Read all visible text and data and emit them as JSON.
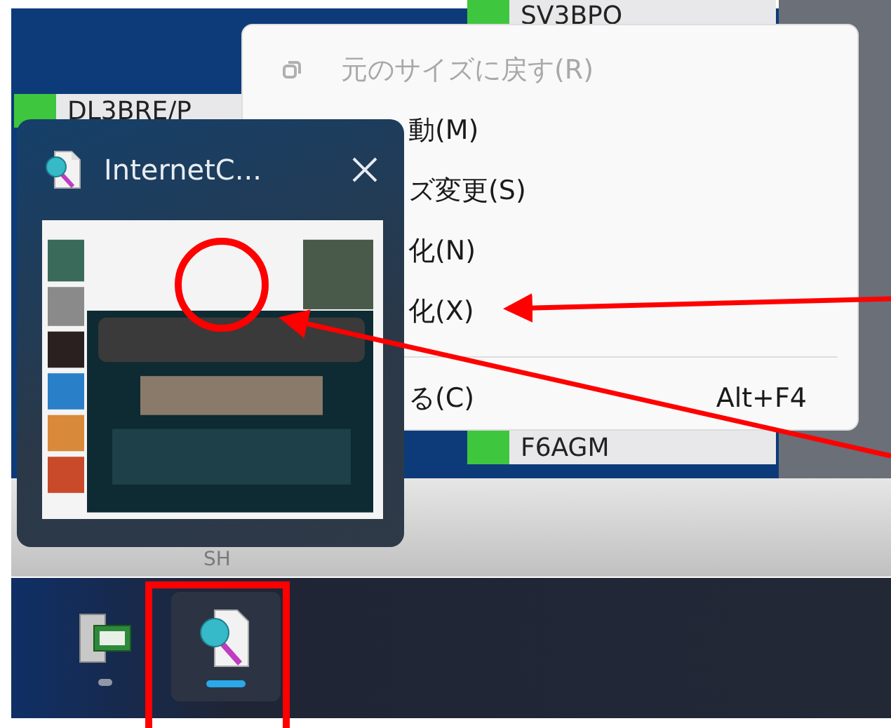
{
  "background_window": {
    "callsigns": [
      {
        "text": "SV3BPO",
        "color": "#3fc63f"
      },
      {
        "text": "DL3BRE/P",
        "color": "#3fc63f"
      },
      {
        "text": "F6AGM",
        "color": "#3fc63f"
      }
    ],
    "footer_text": "SH"
  },
  "context_menu": {
    "items": [
      {
        "kind": "restore",
        "label": "元のサイズに戻す(R)",
        "disabled": true
      },
      {
        "kind": "item",
        "label": "動(M)",
        "disabled": false
      },
      {
        "kind": "item",
        "label": "ズ変更(S)",
        "disabled": false
      },
      {
        "kind": "item",
        "label": "化(N)",
        "disabled": false
      },
      {
        "kind": "item",
        "label": "化(X)",
        "disabled": false
      },
      {
        "kind": "separator"
      },
      {
        "kind": "item",
        "label": "る(C)",
        "shortcut": "Alt+F4",
        "disabled": false
      }
    ]
  },
  "preview": {
    "title": "InternetC..."
  },
  "taskbar": {
    "apps": [
      {
        "selected": false
      },
      {
        "selected": true
      }
    ]
  }
}
